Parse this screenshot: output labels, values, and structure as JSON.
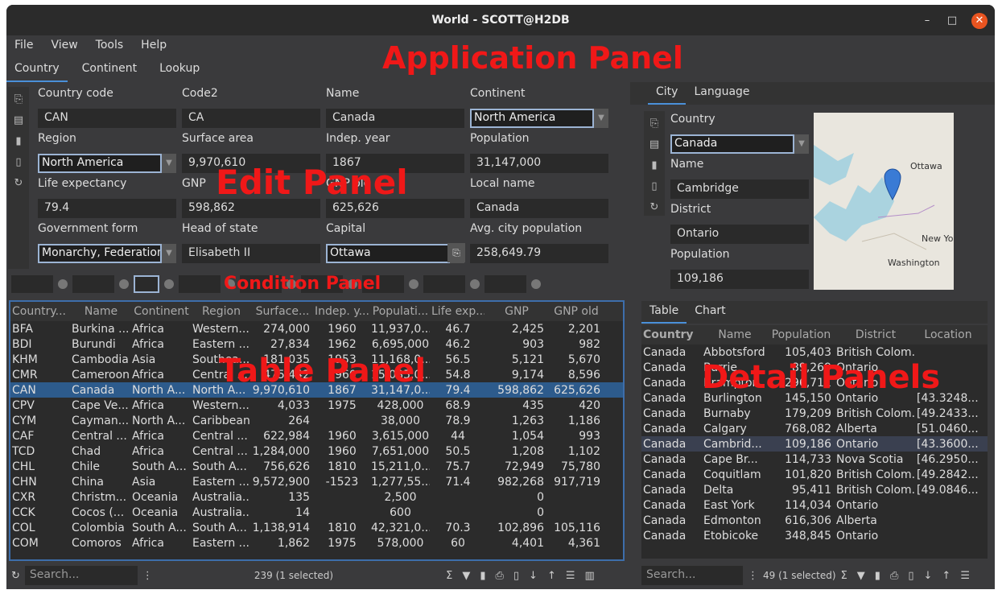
{
  "window": {
    "title": "World - SCOTT@H2DB",
    "minimize": "–",
    "maximize": "□",
    "close": "✕"
  },
  "menu": [
    "File",
    "View",
    "Tools",
    "Help"
  ],
  "main_tabs": [
    "Country",
    "Continent",
    "Lookup"
  ],
  "labels": {
    "application_panel": "Application Panel",
    "edit_panel": "Edit Panel",
    "condition_panel": "Condition Panel",
    "table_panel": "Table Panel",
    "detail_panels": "Detail Panels"
  },
  "edit": {
    "country_code": {
      "label": "Country code",
      "value": "CAN"
    },
    "code2": {
      "label": "Code2",
      "value": "CA"
    },
    "name": {
      "label": "Name",
      "value": "Canada"
    },
    "continent": {
      "label": "Continent",
      "value": "North America"
    },
    "region": {
      "label": "Region",
      "value": "North America"
    },
    "surface_area": {
      "label": "Surface area",
      "value": "9,970,610"
    },
    "indep_year": {
      "label": "Indep. year",
      "value": "1867"
    },
    "population": {
      "label": "Population",
      "value": "31,147,000"
    },
    "life_expectancy": {
      "label": "Life expectancy",
      "value": "79.4"
    },
    "gnp": {
      "label": "GNP",
      "value": "598,862"
    },
    "gnp_old": {
      "label": "GNP old",
      "value": "625,626"
    },
    "local_name": {
      "label": "Local name",
      "value": "Canada"
    },
    "government_form": {
      "label": "Government form",
      "value": "Monarchy, Federation"
    },
    "head_of_state": {
      "label": "Head of state",
      "value": "Elisabeth II"
    },
    "capital": {
      "label": "Capital",
      "value": "Ottawa"
    },
    "avg_city_population": {
      "label": "Avg. city population",
      "value": "258,649.79"
    }
  },
  "table": {
    "headers": [
      "Country...",
      "Name",
      "Continent",
      "Region",
      "Surface...",
      "Indep. y...",
      "Populati...",
      "Life exp...",
      "GNP",
      "GNP old"
    ],
    "rows": [
      [
        "BFA",
        "Burkina ...",
        "Africa",
        "Western...",
        "274,000",
        "1960",
        "11,937,0...",
        "46.7",
        "2,425",
        "2,201"
      ],
      [
        "BDI",
        "Burundi",
        "Africa",
        "Eastern ...",
        "27,834",
        "1962",
        "6,695,000",
        "46.2",
        "903",
        "982"
      ],
      [
        "KHM",
        "Cambodia",
        "Asia",
        "Southea...",
        "181,035",
        "1953",
        "11,168,0...",
        "56.5",
        "5,121",
        "5,670"
      ],
      [
        "CMR",
        "Cameroon",
        "Africa",
        "Central ...",
        "475,442",
        "1960",
        "15,085,0...",
        "54.8",
        "9,174",
        "8,596"
      ],
      [
        "CAN",
        "Canada",
        "North A...",
        "North A...",
        "9,970,610",
        "1867",
        "31,147,0...",
        "79.4",
        "598,862",
        "625,626"
      ],
      [
        "CPV",
        "Cape Ve...",
        "Africa",
        "Western...",
        "4,033",
        "1975",
        "428,000",
        "68.9",
        "435",
        "420"
      ],
      [
        "CYM",
        "Cayman...",
        "North A...",
        "Caribbean",
        "264",
        "",
        "38,000",
        "78.9",
        "1,263",
        "1,186"
      ],
      [
        "CAF",
        "Central ...",
        "Africa",
        "Central ...",
        "622,984",
        "1960",
        "3,615,000",
        "44",
        "1,054",
        "993"
      ],
      [
        "TCD",
        "Chad",
        "Africa",
        "Central ...",
        "1,284,000",
        "1960",
        "7,651,000",
        "50.5",
        "1,208",
        "1,102"
      ],
      [
        "CHL",
        "Chile",
        "South A...",
        "South A...",
        "756,626",
        "1810",
        "15,211,0...",
        "75.7",
        "72,949",
        "75,780"
      ],
      [
        "CHN",
        "China",
        "Asia",
        "Eastern ...",
        "9,572,900",
        "-1523",
        "1,277,55...",
        "71.4",
        "982,268",
        "917,719"
      ],
      [
        "CXR",
        "Christm...",
        "Oceania",
        "Australia...",
        "135",
        "",
        "2,500",
        "",
        "0",
        ""
      ],
      [
        "CCK",
        "Cocos (...",
        "Oceania",
        "Australia...",
        "14",
        "",
        "600",
        "",
        "0",
        ""
      ],
      [
        "COL",
        "Colombia",
        "South A...",
        "South A...",
        "1,138,914",
        "1810",
        "42,321,0...",
        "70.3",
        "102,896",
        "105,116"
      ],
      [
        "COM",
        "Comoros",
        "Africa",
        "Eastern ...",
        "1,862",
        "1975",
        "578,000",
        "60",
        "4,401",
        "4,361"
      ]
    ],
    "selected_index": 4
  },
  "status": {
    "search_placeholder": "Search...",
    "count": "239 (1 selected)"
  },
  "detail": {
    "tabs": [
      "City",
      "Language"
    ],
    "country": {
      "label": "Country",
      "value": "Canada"
    },
    "name": {
      "label": "Name",
      "value": "Cambridge"
    },
    "district": {
      "label": "District",
      "value": "Ontario"
    },
    "population": {
      "label": "Population",
      "value": "109,186"
    },
    "map_labels": {
      "ottawa": "Ottawa",
      "newyork": "New Yo",
      "washington": "Washington"
    },
    "lower_tabs": [
      "Table",
      "Chart"
    ],
    "headers": [
      "Country",
      "Name",
      "Population",
      "District",
      "Location"
    ],
    "rows": [
      [
        "Canada",
        "Abbotsford",
        "105,403",
        "British Colom...",
        ""
      ],
      [
        "Canada",
        "Barrie",
        "89,269",
        "Ontario",
        ""
      ],
      [
        "Canada",
        "Brampton",
        "296,711",
        "Ontario",
        ""
      ],
      [
        "Canada",
        "Burlington",
        "145,150",
        "Ontario",
        "[43.3248..."
      ],
      [
        "Canada",
        "Burnaby",
        "179,209",
        "British Colom...",
        "[49.2433..."
      ],
      [
        "Canada",
        "Calgary",
        "768,082",
        "Alberta",
        "[51.0460..."
      ],
      [
        "Canada",
        "Cambrid...",
        "109,186",
        "Ontario",
        "[43.3600..."
      ],
      [
        "Canada",
        "Cape Br...",
        "114,733",
        "Nova Scotia",
        "[46.2950..."
      ],
      [
        "Canada",
        "Coquitlam",
        "101,820",
        "British Colom...",
        "[49.2842..."
      ],
      [
        "Canada",
        "Delta",
        "95,411",
        "British Colom...",
        "[49.0846..."
      ],
      [
        "Canada",
        "East York",
        "114,034",
        "Ontario",
        ""
      ],
      [
        "Canada",
        "Edmonton",
        "616,306",
        "Alberta",
        ""
      ],
      [
        "Canada",
        "Etobicoke",
        "348,845",
        "Ontario",
        ""
      ]
    ],
    "selected_index": 6,
    "search_placeholder": "Search...",
    "count": "49 (1 selected)"
  }
}
